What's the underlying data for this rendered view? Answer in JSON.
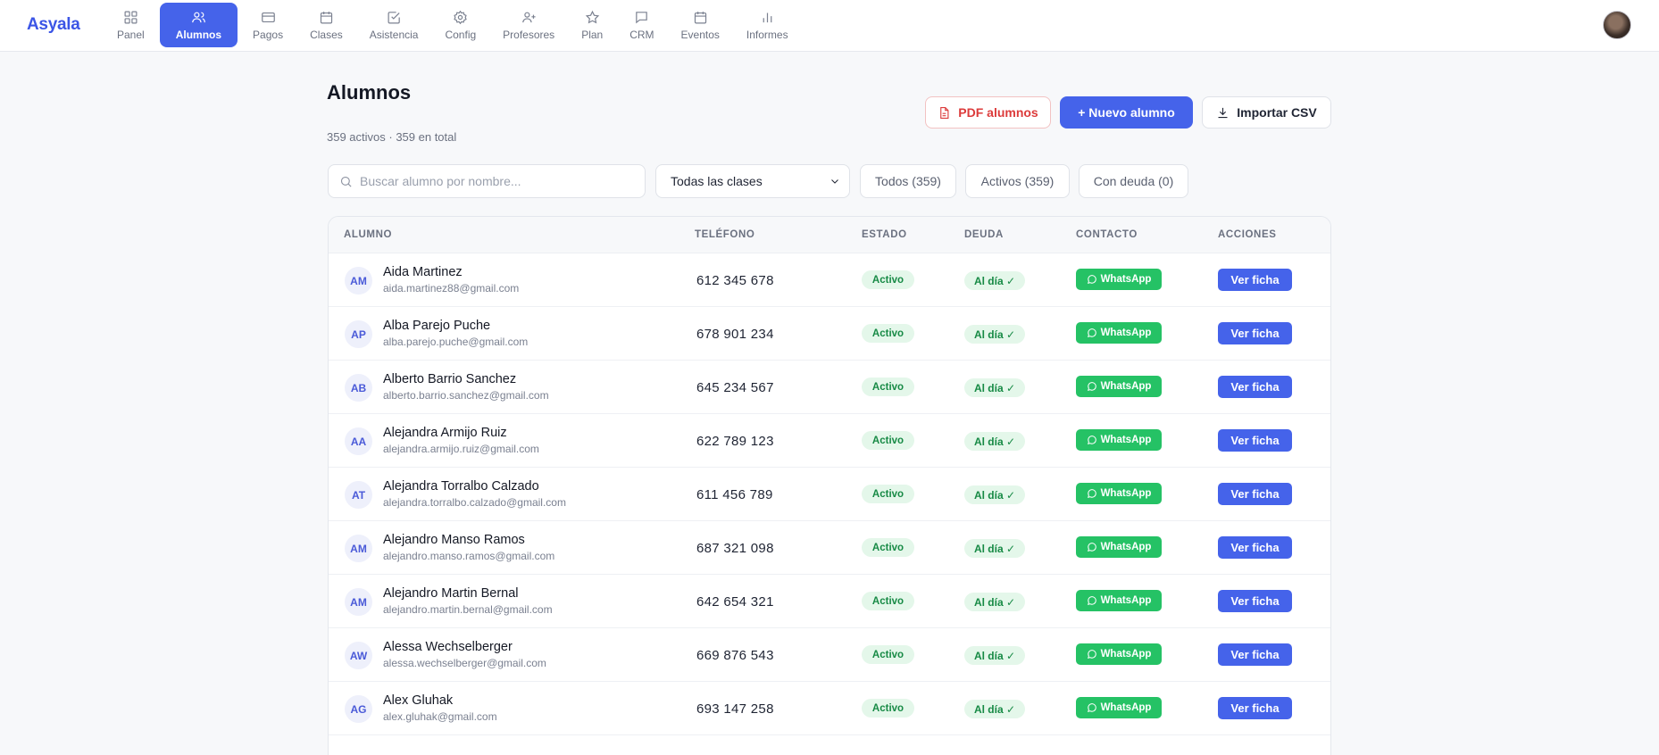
{
  "app": {
    "logo": "Asyala"
  },
  "nav": [
    {
      "label": "Panel",
      "icon": "grid-icon",
      "active": false
    },
    {
      "label": "Alumnos",
      "icon": "users-icon",
      "active": true
    },
    {
      "label": "Pagos",
      "icon": "credit-card-icon",
      "active": false
    },
    {
      "label": "Clases",
      "icon": "calendar-icon",
      "active": false
    },
    {
      "label": "Asistencia",
      "icon": "check-square-icon",
      "active": false
    },
    {
      "label": "Config",
      "icon": "gear-icon",
      "active": false
    },
    {
      "label": "Profesores",
      "icon": "user-plus-icon",
      "active": false
    },
    {
      "label": "Plan",
      "icon": "star-icon",
      "active": false
    },
    {
      "label": "CRM",
      "icon": "message-icon",
      "active": false
    },
    {
      "label": "Eventos",
      "icon": "calendar-icon",
      "active": false
    },
    {
      "label": "Informes",
      "icon": "bar-chart-icon",
      "active": false
    }
  ],
  "page": {
    "title": "Alumnos",
    "subtitle": "359 activos · 359 en total"
  },
  "actions": {
    "pdf_label": "PDF alumnos",
    "new_label": "+ Nuevo alumno",
    "csv_label": "Importar CSV"
  },
  "filters": {
    "search_placeholder": "Buscar alumno por nombre...",
    "class_select": "Todas las clases",
    "chip_all": "Todos (359)",
    "chip_active": "Activos (359)",
    "chip_debt": "Con deuda (0)"
  },
  "table": {
    "headers": {
      "student": "ALUMNO",
      "phone": "TELÉFONO",
      "state": "ESTADO",
      "debt": "DEUDA",
      "contact": "CONTACTO",
      "actions": "ACCIONES"
    },
    "rows": [
      {
        "initials": "AM",
        "name": "Aida Martinez",
        "email": "aida.martinez88@gmail.com",
        "phone": "612 345 678",
        "state": "Activo",
        "debt": "Al día ✓",
        "contact": "WhatsApp",
        "action": "Ver ficha"
      },
      {
        "initials": "AP",
        "name": "Alba Parejo Puche",
        "email": "alba.parejo.puche@gmail.com",
        "phone": "678 901 234",
        "state": "Activo",
        "debt": "Al día ✓",
        "contact": "WhatsApp",
        "action": "Ver ficha"
      },
      {
        "initials": "AB",
        "name": "Alberto Barrio Sanchez",
        "email": "alberto.barrio.sanchez@gmail.com",
        "phone": "645 234 567",
        "state": "Activo",
        "debt": "Al día ✓",
        "contact": "WhatsApp",
        "action": "Ver ficha"
      },
      {
        "initials": "AA",
        "name": "Alejandra Armijo Ruiz",
        "email": "alejandra.armijo.ruiz@gmail.com",
        "phone": "622 789 123",
        "state": "Activo",
        "debt": "Al día ✓",
        "contact": "WhatsApp",
        "action": "Ver ficha"
      },
      {
        "initials": "AT",
        "name": "Alejandra Torralbo Calzado",
        "email": "alejandra.torralbo.calzado@gmail.com",
        "phone": "611 456 789",
        "state": "Activo",
        "debt": "Al día ✓",
        "contact": "WhatsApp",
        "action": "Ver ficha"
      },
      {
        "initials": "AM",
        "name": "Alejandro Manso Ramos",
        "email": "alejandro.manso.ramos@gmail.com",
        "phone": "687 321 098",
        "state": "Activo",
        "debt": "Al día ✓",
        "contact": "WhatsApp",
        "action": "Ver ficha"
      },
      {
        "initials": "AM",
        "name": "Alejandro Martin Bernal",
        "email": "alejandro.martin.bernal@gmail.com",
        "phone": "642 654 321",
        "state": "Activo",
        "debt": "Al día ✓",
        "contact": "WhatsApp",
        "action": "Ver ficha"
      },
      {
        "initials": "AW",
        "name": "Alessa Wechselberger",
        "email": "alessa.wechselberger@gmail.com",
        "phone": "669 876 543",
        "state": "Activo",
        "debt": "Al día ✓",
        "contact": "WhatsApp",
        "action": "Ver ficha"
      },
      {
        "initials": "AG",
        "name": "Alex Gluhak",
        "email": "alex.gluhak@gmail.com",
        "phone": "693 147 258",
        "state": "Activo",
        "debt": "Al día ✓",
        "contact": "WhatsApp",
        "action": "Ver ficha"
      }
    ]
  },
  "colors": {
    "accent": "#4563ea",
    "whatsapp": "#25c265",
    "success_bg": "#e4f7ea",
    "success_text": "#178a45",
    "danger": "#dc3b3b"
  }
}
